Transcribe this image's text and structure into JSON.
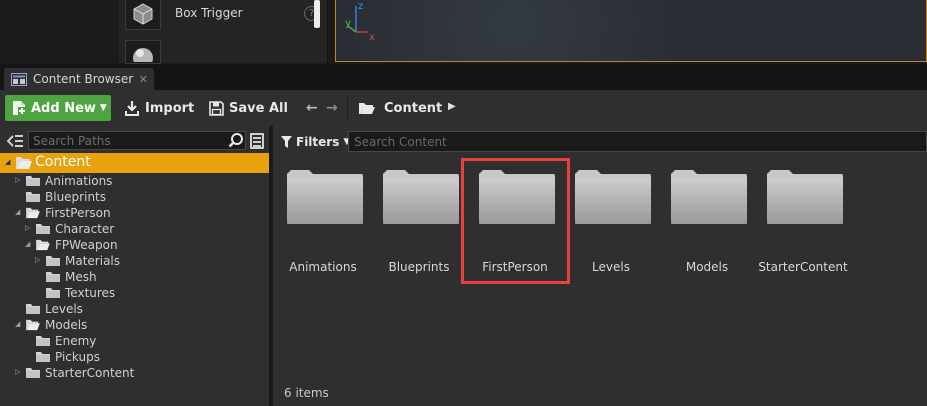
{
  "top": {
    "place_items": [
      {
        "label": "Box Trigger",
        "help": "?"
      },
      {
        "label": "",
        "help": ""
      }
    ]
  },
  "tab": {
    "title": "Content Browser",
    "close": "✕"
  },
  "toolbar": {
    "add_new_label": "Add New",
    "import_label": "Import",
    "save_all_label": "Save All",
    "back": "←",
    "forward": "→",
    "path_label": "Content",
    "path_arrow": "▶"
  },
  "sources": {
    "search_placeholder": "Search Paths",
    "tree": [
      {
        "label": "Content",
        "depth": 0,
        "expanded": true,
        "selected": true,
        "has_children": true
      },
      {
        "label": "Animations",
        "depth": 1,
        "expanded": false,
        "has_children": true
      },
      {
        "label": "Blueprints",
        "depth": 1,
        "expanded": false,
        "has_children": false
      },
      {
        "label": "FirstPerson",
        "depth": 1,
        "expanded": true,
        "has_children": true
      },
      {
        "label": "Character",
        "depth": 2,
        "expanded": false,
        "has_children": true
      },
      {
        "label": "FPWeapon",
        "depth": 2,
        "expanded": true,
        "has_children": true
      },
      {
        "label": "Materials",
        "depth": 3,
        "expanded": false,
        "has_children": true
      },
      {
        "label": "Mesh",
        "depth": 3,
        "expanded": false,
        "has_children": false
      },
      {
        "label": "Textures",
        "depth": 3,
        "expanded": false,
        "has_children": false
      },
      {
        "label": "Levels",
        "depth": 1,
        "expanded": false,
        "has_children": false
      },
      {
        "label": "Models",
        "depth": 1,
        "expanded": true,
        "has_children": true
      },
      {
        "label": "Enemy",
        "depth": 2,
        "expanded": false,
        "has_children": false
      },
      {
        "label": "Pickups",
        "depth": 2,
        "expanded": false,
        "has_children": false
      },
      {
        "label": "StarterContent",
        "depth": 1,
        "expanded": false,
        "has_children": true
      }
    ]
  },
  "assets": {
    "filters_label": "Filters",
    "search_placeholder": "Search Content",
    "items": [
      {
        "label": "Animations"
      },
      {
        "label": "Blueprints"
      },
      {
        "label": "FirstPerson",
        "highlighted": true
      },
      {
        "label": "Levels"
      },
      {
        "label": "Models"
      },
      {
        "label": "StarterContent"
      }
    ],
    "item_count": "6 items"
  },
  "colors": {
    "selection": "#e8a20e",
    "add_new": "#4da440",
    "highlight": "#e8413c",
    "panel": "#2f2f2f"
  }
}
